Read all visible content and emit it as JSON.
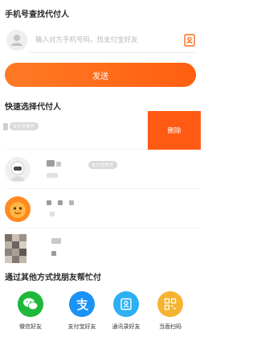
{
  "search_section": {
    "title": "手机号查找代付人",
    "placeholder": "输入对方手机号码，找支付宝好友",
    "send_label": "发送"
  },
  "quick_section": {
    "title": "快速选择代付人",
    "delete_label": "删除",
    "contacts": [
      {
        "name_masked": true,
        "badge": "支付宝账号"
      },
      {
        "name_masked": true,
        "badge": "支付宝账号"
      },
      {
        "name_masked": true,
        "badge": ""
      },
      {
        "name_masked": true,
        "badge": ""
      }
    ]
  },
  "friends_section": {
    "title": "通过其他方式找朋友帮忙付",
    "options": [
      {
        "label": "微信好友",
        "icon": "wechat-icon",
        "color": "#1fb83a"
      },
      {
        "label": "支付宝好友",
        "icon": "alipay-icon",
        "color": "#1b93f5"
      },
      {
        "label": "通讯录好友",
        "icon": "contacts-icon",
        "color": "#2db0f3"
      },
      {
        "label": "当面扫码",
        "icon": "qr-code-icon",
        "color": "#f5b332"
      }
    ]
  }
}
